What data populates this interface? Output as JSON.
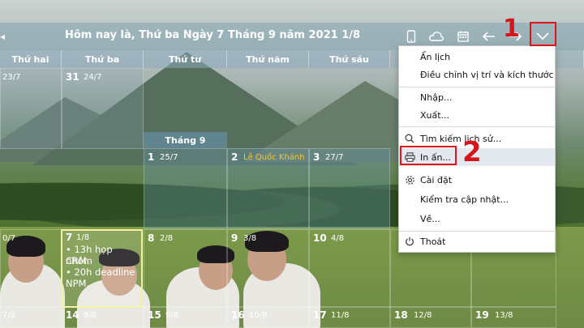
{
  "header": {
    "title": "Hôm nay là, Thứ ba Ngày 7 Tháng 9 năm 2021 1/8"
  },
  "toolbar": {
    "icons": [
      "phone-icon",
      "cloud-icon",
      "calendar-icon",
      "arrow-left-icon",
      "arrow-right-icon",
      "chevron-down-icon"
    ]
  },
  "weekdays": [
    "Thứ hai",
    "Thứ ba",
    "Thứ tư",
    "Thứ năm",
    "Thứ sáu"
  ],
  "month_label": "Tháng 9",
  "cells": {
    "r1c1_lunar": "23/7",
    "r1c2_num": "31",
    "r1c2_lunar": "24/7",
    "d1_num": "1",
    "d1_lunar": "25/7",
    "d2_num": "2",
    "d2_holiday": "Lễ Quốc Khánh",
    "d3_num": "3",
    "d3_lunar": "27/7",
    "r3c1_lunar": "0/7",
    "d7_num": "7",
    "d7_lunar": "1/8",
    "d8_num": "8",
    "d8_lunar": "2/8",
    "d9_num": "9",
    "d9_lunar": "3/8",
    "d10_num": "10",
    "d10_lunar": "4/8",
    "r4c1_lunar": "7/8",
    "d14_num": "14",
    "d14_lunar": "8/8",
    "d15_num": "15",
    "d15_lunar": "9/8",
    "d16_num": "16",
    "d16_lunar": "10/8",
    "d17_num": "17",
    "d17_lunar": "11/8",
    "d18_num": "18",
    "d18_lunar": "12/8",
    "d19_num": "19",
    "d19_lunar": "13/8"
  },
  "notes": {
    "line1": "• 13h họp nhóm",
    "line2": "CRM.",
    "line3": "• 20h deadline",
    "line4": "NPM."
  },
  "menu": {
    "items": [
      {
        "label": "Ẩn lịch"
      },
      {
        "label": "Điều chỉnh vị trí và kích thước"
      },
      {
        "label": "Nhập..."
      },
      {
        "label": "Xuất..."
      },
      {
        "label": "Tìm kiếm lịch sử..."
      },
      {
        "label": "In ấn..."
      },
      {
        "label": "Cài đặt"
      },
      {
        "label": "Kiểm tra cập nhật..."
      },
      {
        "label": "Về..."
      },
      {
        "label": "Thoát"
      }
    ]
  },
  "annotations": {
    "step1": "1",
    "step2": "2"
  },
  "colors": {
    "highlight_red": "#e0151c",
    "holiday_yellow": "#f6c62a",
    "menu_highlight": "#e4e9ef"
  }
}
